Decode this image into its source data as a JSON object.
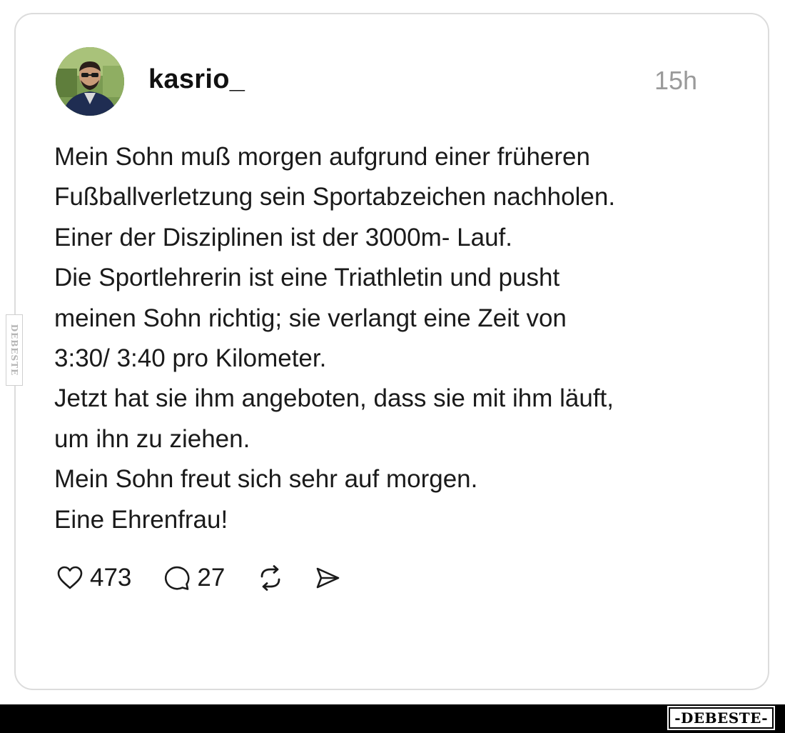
{
  "post": {
    "username": "kasrio_",
    "time": "15h",
    "text_lines": [
      "Mein Sohn muß morgen aufgrund einer früheren",
      "Fußballverletzung sein Sportabzeichen nachholen.",
      "Einer der Disziplinen ist der 3000m- Lauf.",
      "Die Sportlehrerin ist eine Triathletin und pusht",
      "meinen Sohn richtig; sie verlangt eine Zeit von",
      "3:30/ 3:40 pro Kilometer.",
      "Jetzt hat sie ihm angeboten, dass sie mit ihm läuft,",
      "um ihn zu ziehen.",
      "Mein Sohn freut sich sehr auf morgen.",
      "Eine Ehrenfrau!"
    ],
    "likes": "473",
    "replies": "27"
  },
  "icons": {
    "like": "heart-icon",
    "reply": "speech-bubble-icon",
    "repost": "repost-arrows-icon",
    "share": "send-icon"
  },
  "watermark": {
    "side_text": "DEBESTE",
    "logo_text": "-DEBESTE-"
  },
  "colors": {
    "text": "#1a1a1a",
    "muted": "#9a9a9a",
    "card_border": "#dcdcdc",
    "footer": "#000000"
  }
}
